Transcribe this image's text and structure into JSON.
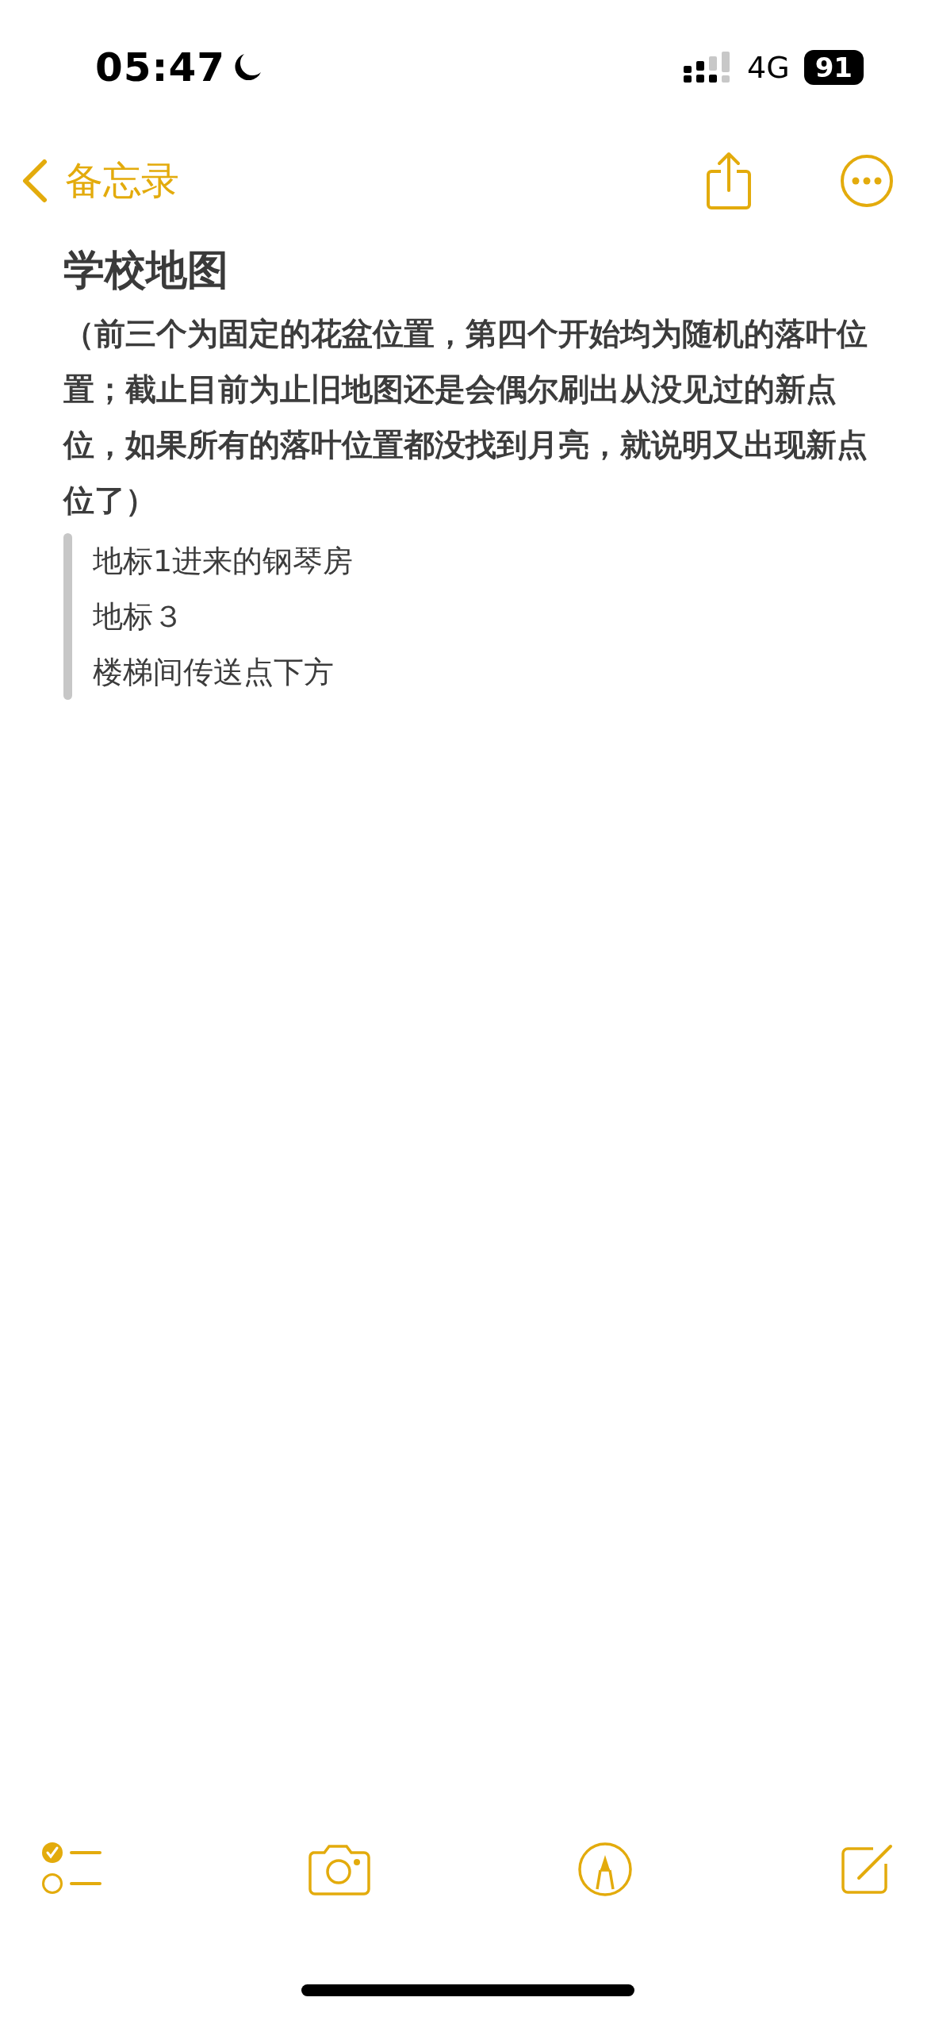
{
  "status_bar": {
    "time": "05:47",
    "network": "4G",
    "battery": "91"
  },
  "nav": {
    "back_label": "备忘录"
  },
  "note": {
    "title": "学校地图",
    "paragraph": "（前三个为固定的花盆位置，第四个开始均为随机的落叶位置；截止目前为止旧地图还是会偶尔刷出从没见过的新点位，如果所有的落叶位置都没找到月亮，就说明又出现新点位了）",
    "quote_lines": [
      "地标1进来的钢琴房",
      "地标３",
      "楼梯间传送点下方"
    ]
  }
}
